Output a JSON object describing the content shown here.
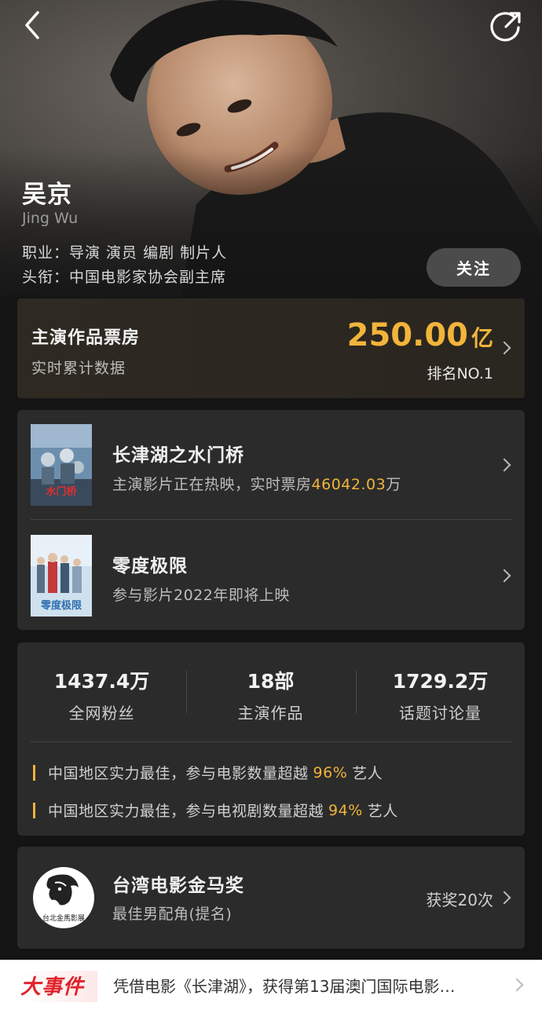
{
  "header": {
    "back_icon": "chevron-left-icon",
    "share_icon": "share-icon"
  },
  "actor": {
    "name": "吴京",
    "name_en": "Jing Wu",
    "profession_line": "职业：导演 演员 编剧 制片人",
    "title_line": "头衔：中国电影家协会副主席",
    "follow_label": "关注"
  },
  "box_office": {
    "title": "主演作品票房",
    "subtitle": "实时累计数据",
    "value": "250.00",
    "unit": "亿",
    "rank": "排名NO.1"
  },
  "movies": [
    {
      "title": "长津湖之水门桥",
      "sub_prefix": "主演影片正在热映，实时票房",
      "sub_value": "46042.03",
      "sub_suffix": "万",
      "poster_text": "水门桥"
    },
    {
      "title": "零度极限",
      "sub_prefix": "参与影片2022年即将上映",
      "sub_value": "",
      "sub_suffix": "",
      "poster_text": "零度极限"
    }
  ],
  "stats": [
    {
      "value": "1437.4万",
      "label": "全网粉丝"
    },
    {
      "value": "18部",
      "label": "主演作品"
    },
    {
      "value": "1729.2万",
      "label": "话题讨论量"
    }
  ],
  "highlights": [
    {
      "prefix": "中国地区实力最佳，参与电影数量超越",
      "pct": "96%",
      "suffix": "艺人"
    },
    {
      "prefix": "中国地区实力最佳，参与电视剧数量超越",
      "pct": "94%",
      "suffix": "艺人"
    }
  ],
  "award": {
    "title": "台湾电影金马奖",
    "subtitle": "最佳男配角(提名)",
    "count": "获奖20次",
    "logo_text": "台北金馬影展"
  },
  "event": {
    "tag": "大事件",
    "text": "凭借电影《长津湖》，获得第13届澳门国际电影…"
  },
  "colors": {
    "accent": "#f2b43a",
    "background": "#141414",
    "card": "#2b2b2b",
    "event_red": "#e0232b"
  }
}
